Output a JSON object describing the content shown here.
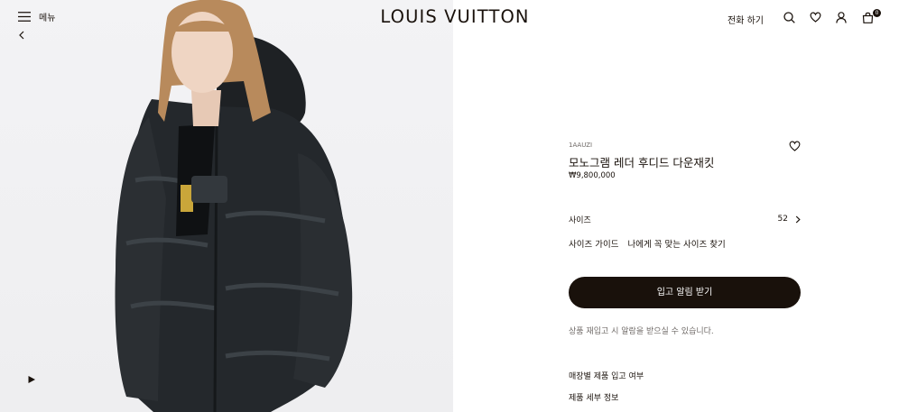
{
  "header": {
    "menu_label": "메뉴",
    "logo": "LOUIS VUITTON",
    "call_label": "전화 하기",
    "cart_count": "0"
  },
  "product": {
    "sku": "1AAUZI",
    "name": "모노그램 레더 후디드 다운재킷",
    "price": "₩9,800,000"
  },
  "size": {
    "label": "사이즈",
    "value": "52"
  },
  "guide": {
    "label": "사이즈 가이드",
    "link": "나에게 꼭 맞는 사이즈 찾기"
  },
  "cta": {
    "button": "입고 알림 받기",
    "note": "상품 재입고 시 알람을 받으실 수 있습니다."
  },
  "links": {
    "store_stock": "매장별 제품 입고 여부",
    "details": "제품 세부 정보"
  },
  "colors": {
    "primary": "#19110b",
    "hero_bg": "#f3f3f5",
    "muted_text": "#6f6a67"
  }
}
